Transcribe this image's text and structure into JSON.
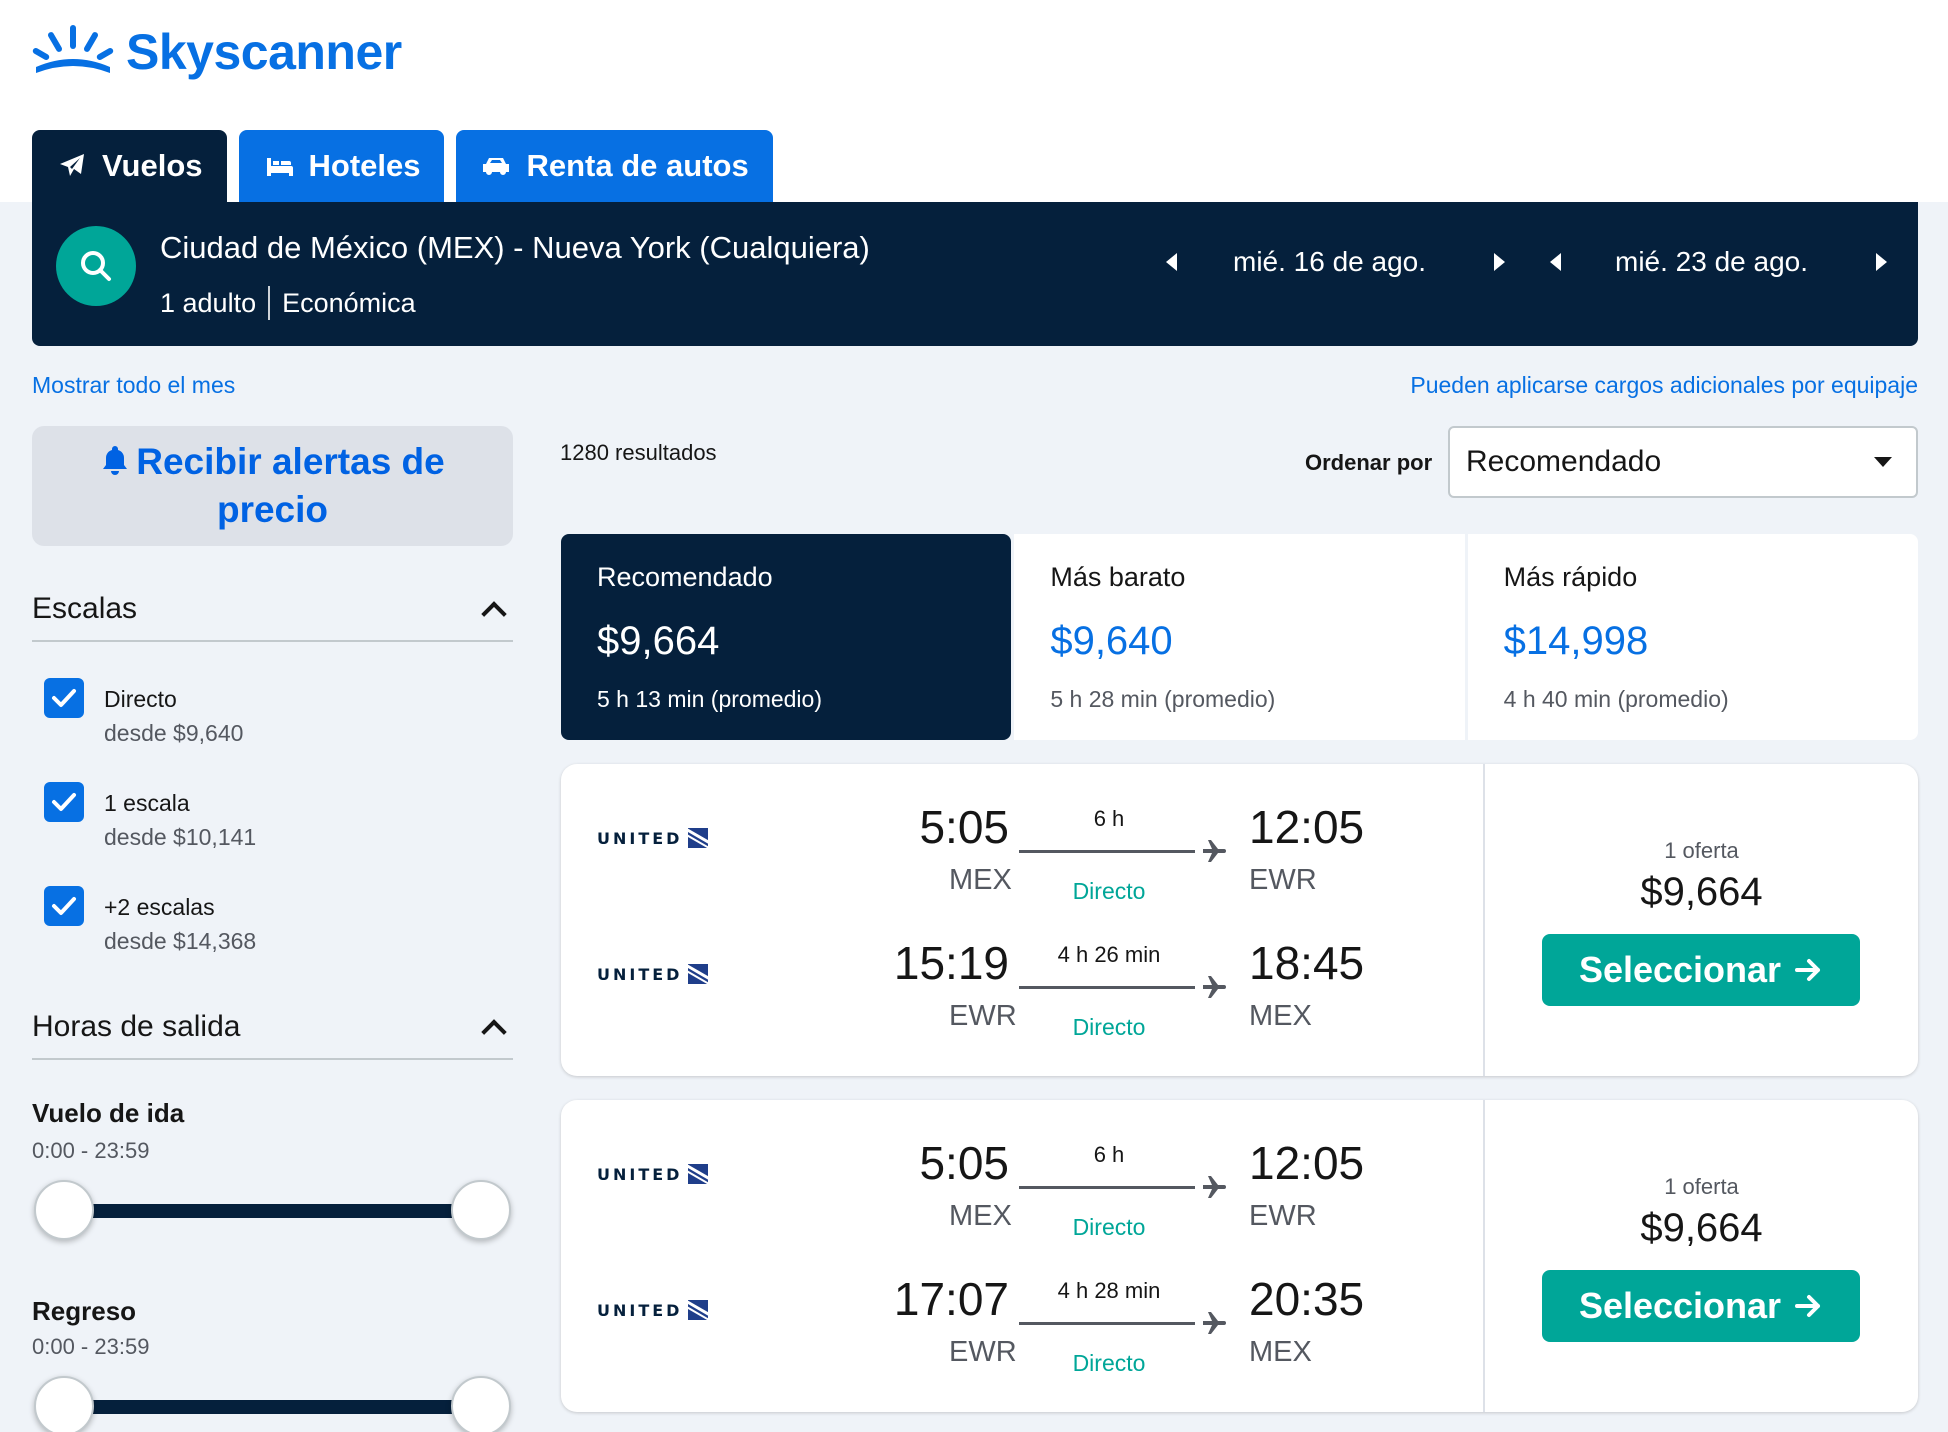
{
  "brand": {
    "name": "Skyscanner",
    "color": "#0770e3"
  },
  "tabs": [
    {
      "label": "Vuelos",
      "icon": "plane-icon",
      "active": true
    },
    {
      "label": "Hoteles",
      "icon": "bed-icon",
      "active": false
    },
    {
      "label": "Renta de autos",
      "icon": "car-icon",
      "active": false
    }
  ],
  "search": {
    "route": "Ciudad de México (MEX) - Nueva York (Cualquiera)",
    "travelers": "1 adulto",
    "cabin": "Económica",
    "depart_date": "mié. 16 de ago.",
    "return_date": "mié. 23 de ago."
  },
  "links": {
    "whole_month": "Mostrar todo el mes",
    "baggage": "Pueden aplicarse cargos adicionales por equipaje"
  },
  "alerts": {
    "label": "Recibir alertas de precio"
  },
  "filters": {
    "stops_title": "Escalas",
    "stops": [
      {
        "label": "Directo",
        "price": "desde $9,640",
        "checked": true
      },
      {
        "label": "1 escala",
        "price": "desde $10,141",
        "checked": true
      },
      {
        "label": "+2 escalas",
        "price": "desde $14,368",
        "checked": true
      }
    ],
    "times_title": "Horas de salida",
    "outbound": {
      "title": "Vuelo de ida",
      "range": "0:00 - 23:59"
    },
    "inbound": {
      "title": "Regreso",
      "range": "0:00 - 23:59"
    }
  },
  "results": {
    "count": "1280 resultados",
    "sort_label": "Ordenar por",
    "sort_value": "Recomendado"
  },
  "sort_tabs": [
    {
      "name": "Recomendado",
      "price": "$9,664",
      "duration": "5 h 13 min (promedio)",
      "active": true
    },
    {
      "name": "Más barato",
      "price": "$9,640",
      "duration": "5 h 28 min (promedio)",
      "active": false
    },
    {
      "name": "Más rápido",
      "price": "$14,998",
      "duration": "4 h 40 min (promedio)",
      "active": false
    }
  ],
  "itineraries": [
    {
      "legs": [
        {
          "airline": "UNITED",
          "dep_time": "5:05",
          "dep_code": "MEX",
          "duration": "6 h",
          "stops": "Directo",
          "arr_time": "12:05",
          "arr_code": "EWR"
        },
        {
          "airline": "UNITED",
          "dep_time": "15:19",
          "dep_code": "EWR",
          "duration": "4 h 26 min",
          "stops": "Directo",
          "arr_time": "18:45",
          "arr_code": "MEX"
        }
      ],
      "offers": "1 oferta",
      "price": "$9,664",
      "button": "Seleccionar"
    },
    {
      "legs": [
        {
          "airline": "UNITED",
          "dep_time": "5:05",
          "dep_code": "MEX",
          "duration": "6 h",
          "stops": "Directo",
          "arr_time": "12:05",
          "arr_code": "EWR"
        },
        {
          "airline": "UNITED",
          "dep_time": "17:07",
          "dep_code": "EWR",
          "duration": "4 h 28 min",
          "stops": "Directo",
          "arr_time": "20:35",
          "arr_code": "MEX"
        }
      ],
      "offers": "1 oferta",
      "price": "$9,664",
      "button": "Seleccionar"
    }
  ],
  "colors": {
    "navy": "#05203c",
    "blue": "#0770e3",
    "teal": "#00a698",
    "background": "#eff3f8"
  }
}
